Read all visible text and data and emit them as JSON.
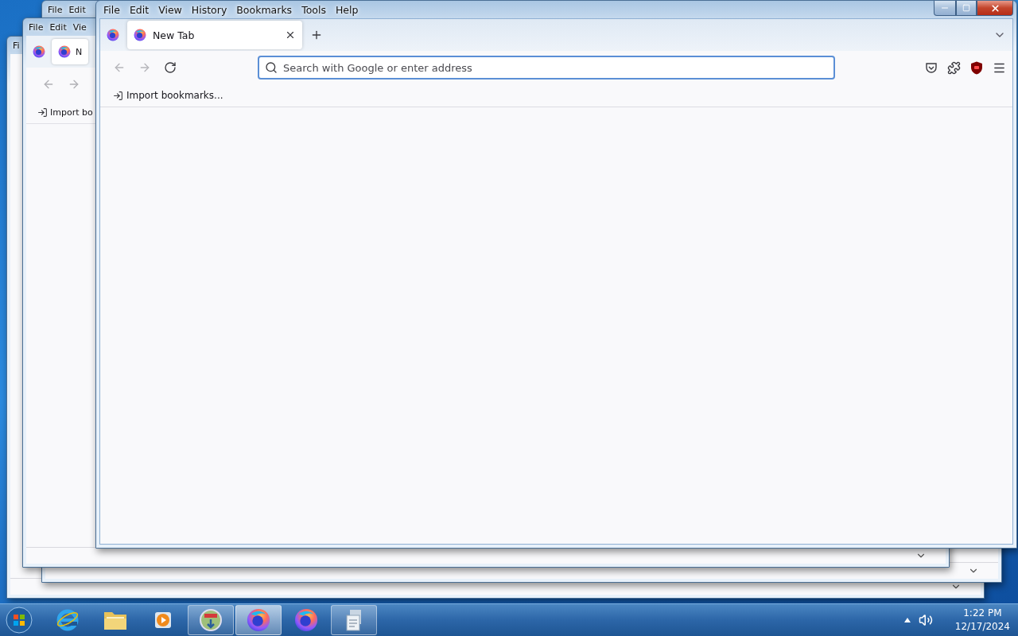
{
  "background_windows": [
    {
      "menu": [
        "Fi"
      ]
    },
    {
      "menu": [
        "File",
        "Edit"
      ]
    },
    {
      "menu": [
        "File",
        "Edit",
        "Vie"
      ],
      "tab_title": "N",
      "bookmark": "Import bo"
    }
  ],
  "window": {
    "menu": [
      "File",
      "Edit",
      "View",
      "History",
      "Bookmarks",
      "Tools",
      "Help"
    ],
    "tabs": [
      {
        "title": "New Tab",
        "selected": true
      }
    ],
    "nav": [
      {
        "kind": "back",
        "disabled": true
      },
      {
        "kind": "forward",
        "disabled": true
      },
      {
        "kind": "reload",
        "disabled": false
      }
    ],
    "address_bar": {
      "placeholder": "Search with Google or enter address"
    },
    "bookmarks": [
      {
        "label": "Import bookmarks..."
      }
    ]
  },
  "taskbar": {
    "apps": [
      {
        "kind": "ie",
        "running": false,
        "selected": false
      },
      {
        "kind": "folder",
        "running": false,
        "selected": false
      },
      {
        "kind": "media",
        "running": false,
        "selected": false
      },
      {
        "kind": "installer",
        "running": true,
        "selected": false
      },
      {
        "kind": "firefox",
        "running": true,
        "selected": true
      },
      {
        "kind": "firefox",
        "running": false,
        "selected": false
      },
      {
        "kind": "document",
        "running": true,
        "selected": false
      }
    ],
    "clock": {
      "time": "1:22 PM",
      "date": "12/17/2024"
    }
  }
}
